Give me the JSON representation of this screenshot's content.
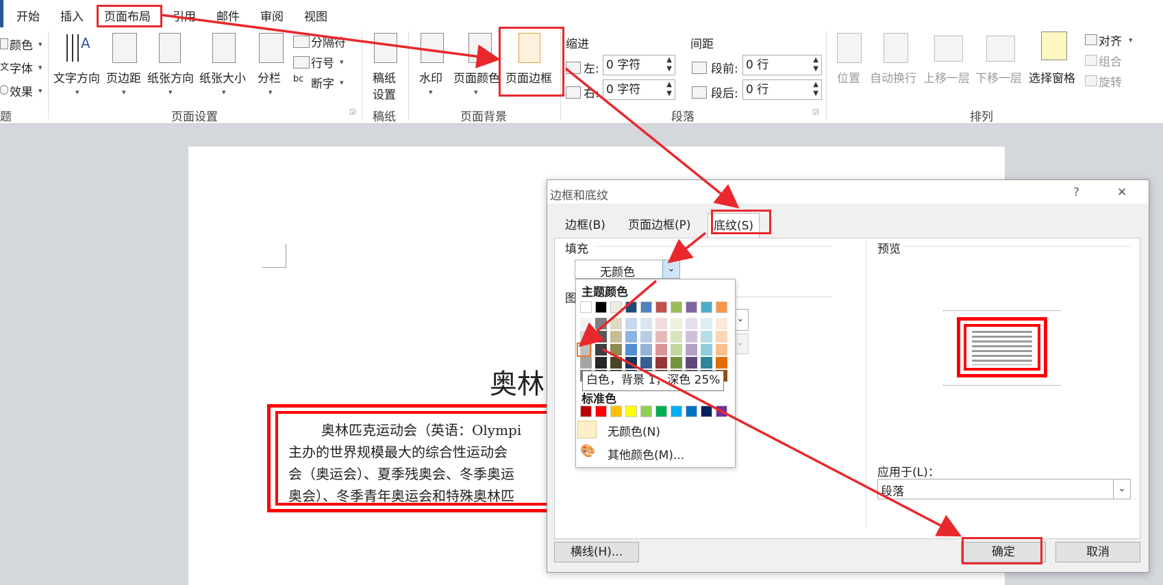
{
  "tabs": [
    "开始",
    "插入",
    "页面布局",
    "引用",
    "邮件",
    "审阅",
    "视图"
  ],
  "ribbon": {
    "theme_items": [
      "颜色",
      "字体",
      "效果"
    ],
    "theme_group": "题",
    "page_setup": {
      "buttons": [
        "文字方向",
        "页边距",
        "纸张方向",
        "纸张大小",
        "分栏"
      ],
      "small": [
        "分隔符",
        "行号",
        "断字"
      ],
      "label": "页面设置"
    },
    "manuscript": {
      "button_line1": "稿纸",
      "button_line2": "设置",
      "label": "稿纸"
    },
    "page_background": {
      "buttons": [
        "水印",
        "页面颜色",
        "页面边框"
      ],
      "label": "页面背景"
    },
    "paragraph": {
      "indent_title": "缩进",
      "spacing_title": "间距",
      "left_label": "左:",
      "right_label": "右:",
      "left_value": "0 字符",
      "right_value": "0 字符",
      "before_label": "段前:",
      "after_label": "段后:",
      "before_value": "0 行",
      "after_value": "0 行",
      "label": "段落"
    },
    "arrange": {
      "buttons": [
        "位置",
        "自动换行",
        "上移一层",
        "下移一层",
        "选择窗格"
      ],
      "small": [
        "对齐",
        "组合",
        "旋转"
      ],
      "label": "排列"
    }
  },
  "document": {
    "title": "奥林",
    "lines": [
      "奥林匹克运动会（英语：Olympi",
      "主办的世界规模最大的综合性运动会",
      "会（奥运会）、夏季残奥会、冬季奥运",
      "奥会）、冬季青年奥运会和特殊奥林匹"
    ]
  },
  "dialog": {
    "title": "边框和底纹",
    "help": "?",
    "close": "✕",
    "tabs": [
      "边框(B)",
      "页面边框(P)",
      "底纹(S)"
    ],
    "fill_label": "填充",
    "fill_value": "无颜色",
    "pattern_label": "图",
    "preview_label": "预览",
    "apply_label": "应用于(L)：",
    "apply_value": "段落",
    "horizontal_line": "横线(H)...",
    "ok": "确定",
    "cancel": "取消"
  },
  "palette": {
    "theme_title": "主题颜色",
    "standard_title": "标准色",
    "no_color": "无颜色(N)",
    "more_colors": "其他颜色(M)...",
    "tooltip": "白色，背景 1，深色 25%",
    "theme_top": [
      "#ffffff",
      "#000000",
      "#eeece1",
      "#1f497d",
      "#4f81bd",
      "#c0504d",
      "#9bbb59",
      "#8064a2",
      "#4bacc6",
      "#f79646"
    ],
    "theme_shades": [
      [
        "#f2f2f2",
        "#7f7f7f",
        "#ddd9c3",
        "#c6d9f0",
        "#dbe5f1",
        "#f2dcdb",
        "#ebf1dd",
        "#e5e0ec",
        "#dbeef3",
        "#fdeada"
      ],
      [
        "#d8d8d8",
        "#595959",
        "#c4bd97",
        "#8db3e2",
        "#b8cce4",
        "#e5b9b7",
        "#d7e3bc",
        "#ccc1d9",
        "#b7dde8",
        "#fbd5b5"
      ],
      [
        "#bfbfbf",
        "#3f3f3f",
        "#938953",
        "#548dd4",
        "#95b3d7",
        "#d99694",
        "#c3d69b",
        "#b2a2c7",
        "#92cddc",
        "#fac08f"
      ],
      [
        "#a5a5a5",
        "#262626",
        "#494429",
        "#17365d",
        "#366092",
        "#953734",
        "#76923c",
        "#5f497a",
        "#31859b",
        "#e36c09"
      ],
      [
        "#7f7f7f",
        "#0c0c0c",
        "#1d1b10",
        "#0f243e",
        "#244061",
        "#632423",
        "#4f6128",
        "#3f3151",
        "#205867",
        "#974806"
      ]
    ],
    "standard": [
      "#c00000",
      "#ff0000",
      "#ffc000",
      "#ffff00",
      "#92d050",
      "#00b050",
      "#00b0f0",
      "#0070c0",
      "#002060",
      "#7030a0"
    ]
  },
  "accent": "#e8282c"
}
